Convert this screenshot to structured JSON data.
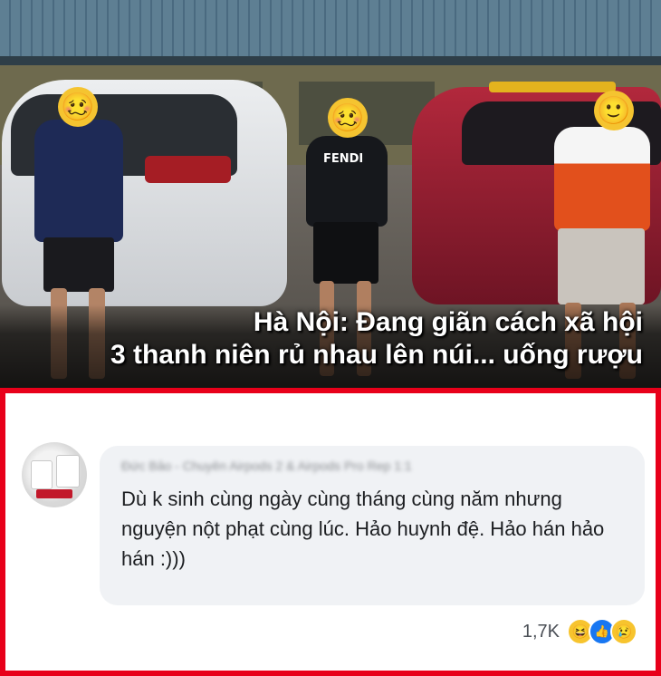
{
  "photo": {
    "caption_line1": "Hà Nội: Đang giãn cách xã hội",
    "caption_line2": "3 thanh niên rủ nhau lên núi... uống rượu",
    "shirt_text": "FENDI",
    "face_emojis": [
      "🥴",
      "🥴",
      "🙂"
    ]
  },
  "comment": {
    "author": "Đức Bảo - Chuyên Airpods 2 & Airpods Pro Rep 1:1",
    "text": "Dù k sinh cùng ngày cùng tháng cùng năm nhưng nguyện nột phạt cùng lúc. Hảo huynh đệ. Hảo hán hảo hán :)))",
    "reaction_count": "1,7K",
    "reaction_icons": [
      "haha-icon",
      "like-icon",
      "sad-icon"
    ]
  },
  "colors": {
    "panel_border": "#e8001a",
    "bubble": "#f0f2f5",
    "caption_text": "#ffffff"
  }
}
